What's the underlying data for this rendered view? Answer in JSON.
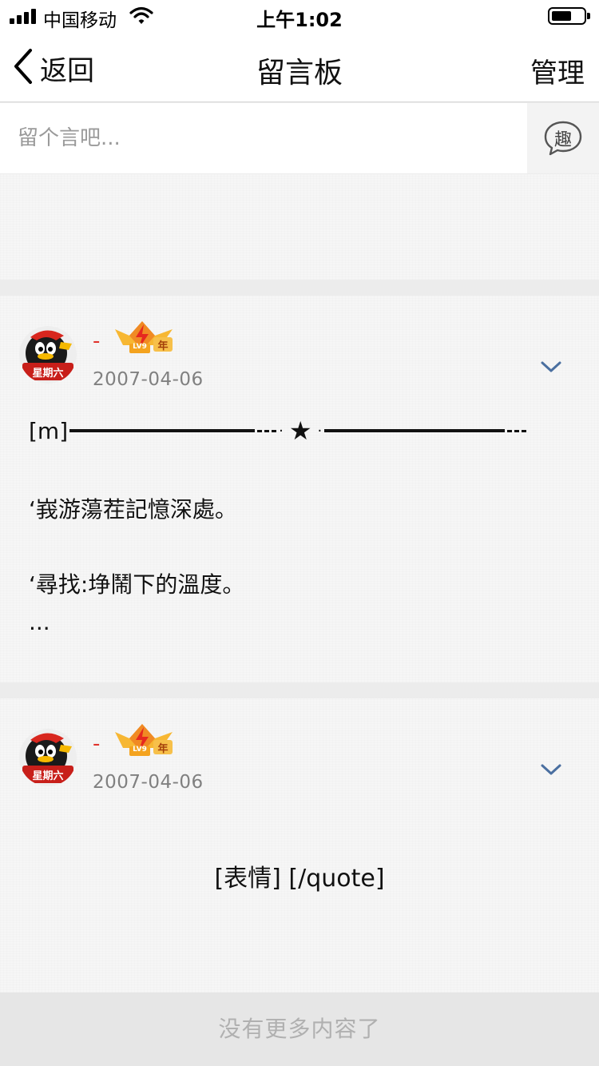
{
  "status_bar": {
    "carrier": "中国移动",
    "time": "上午1:02"
  },
  "nav": {
    "back_label": "返回",
    "title": "留言板",
    "manage_label": "管理"
  },
  "compose": {
    "placeholder": "留个言吧...",
    "emoji_button_glyph": "趣"
  },
  "posts": [
    {
      "nickname": "-",
      "avatar_text": "星期六",
      "badge_level": "LV9",
      "badge_suffix": "年",
      "date": "2007-04-06",
      "divider_prefix": "[m]",
      "line1": "‘峩游蕩茬記憶深處。",
      "line2": "‘尋找:埩鬧下的溫度。",
      "ellipsis": "..."
    },
    {
      "nickname": "-",
      "avatar_text": "星期六",
      "badge_level": "LV9",
      "badge_suffix": "年",
      "date": "2007-04-06",
      "content": "[表情] [/quote]"
    }
  ],
  "footer": {
    "text": "没有更多内容了"
  },
  "colors": {
    "nickname": "#e0322b",
    "date": "#808080",
    "footer_text": "#b0b0b0",
    "chevron": "#4a6fa0"
  }
}
